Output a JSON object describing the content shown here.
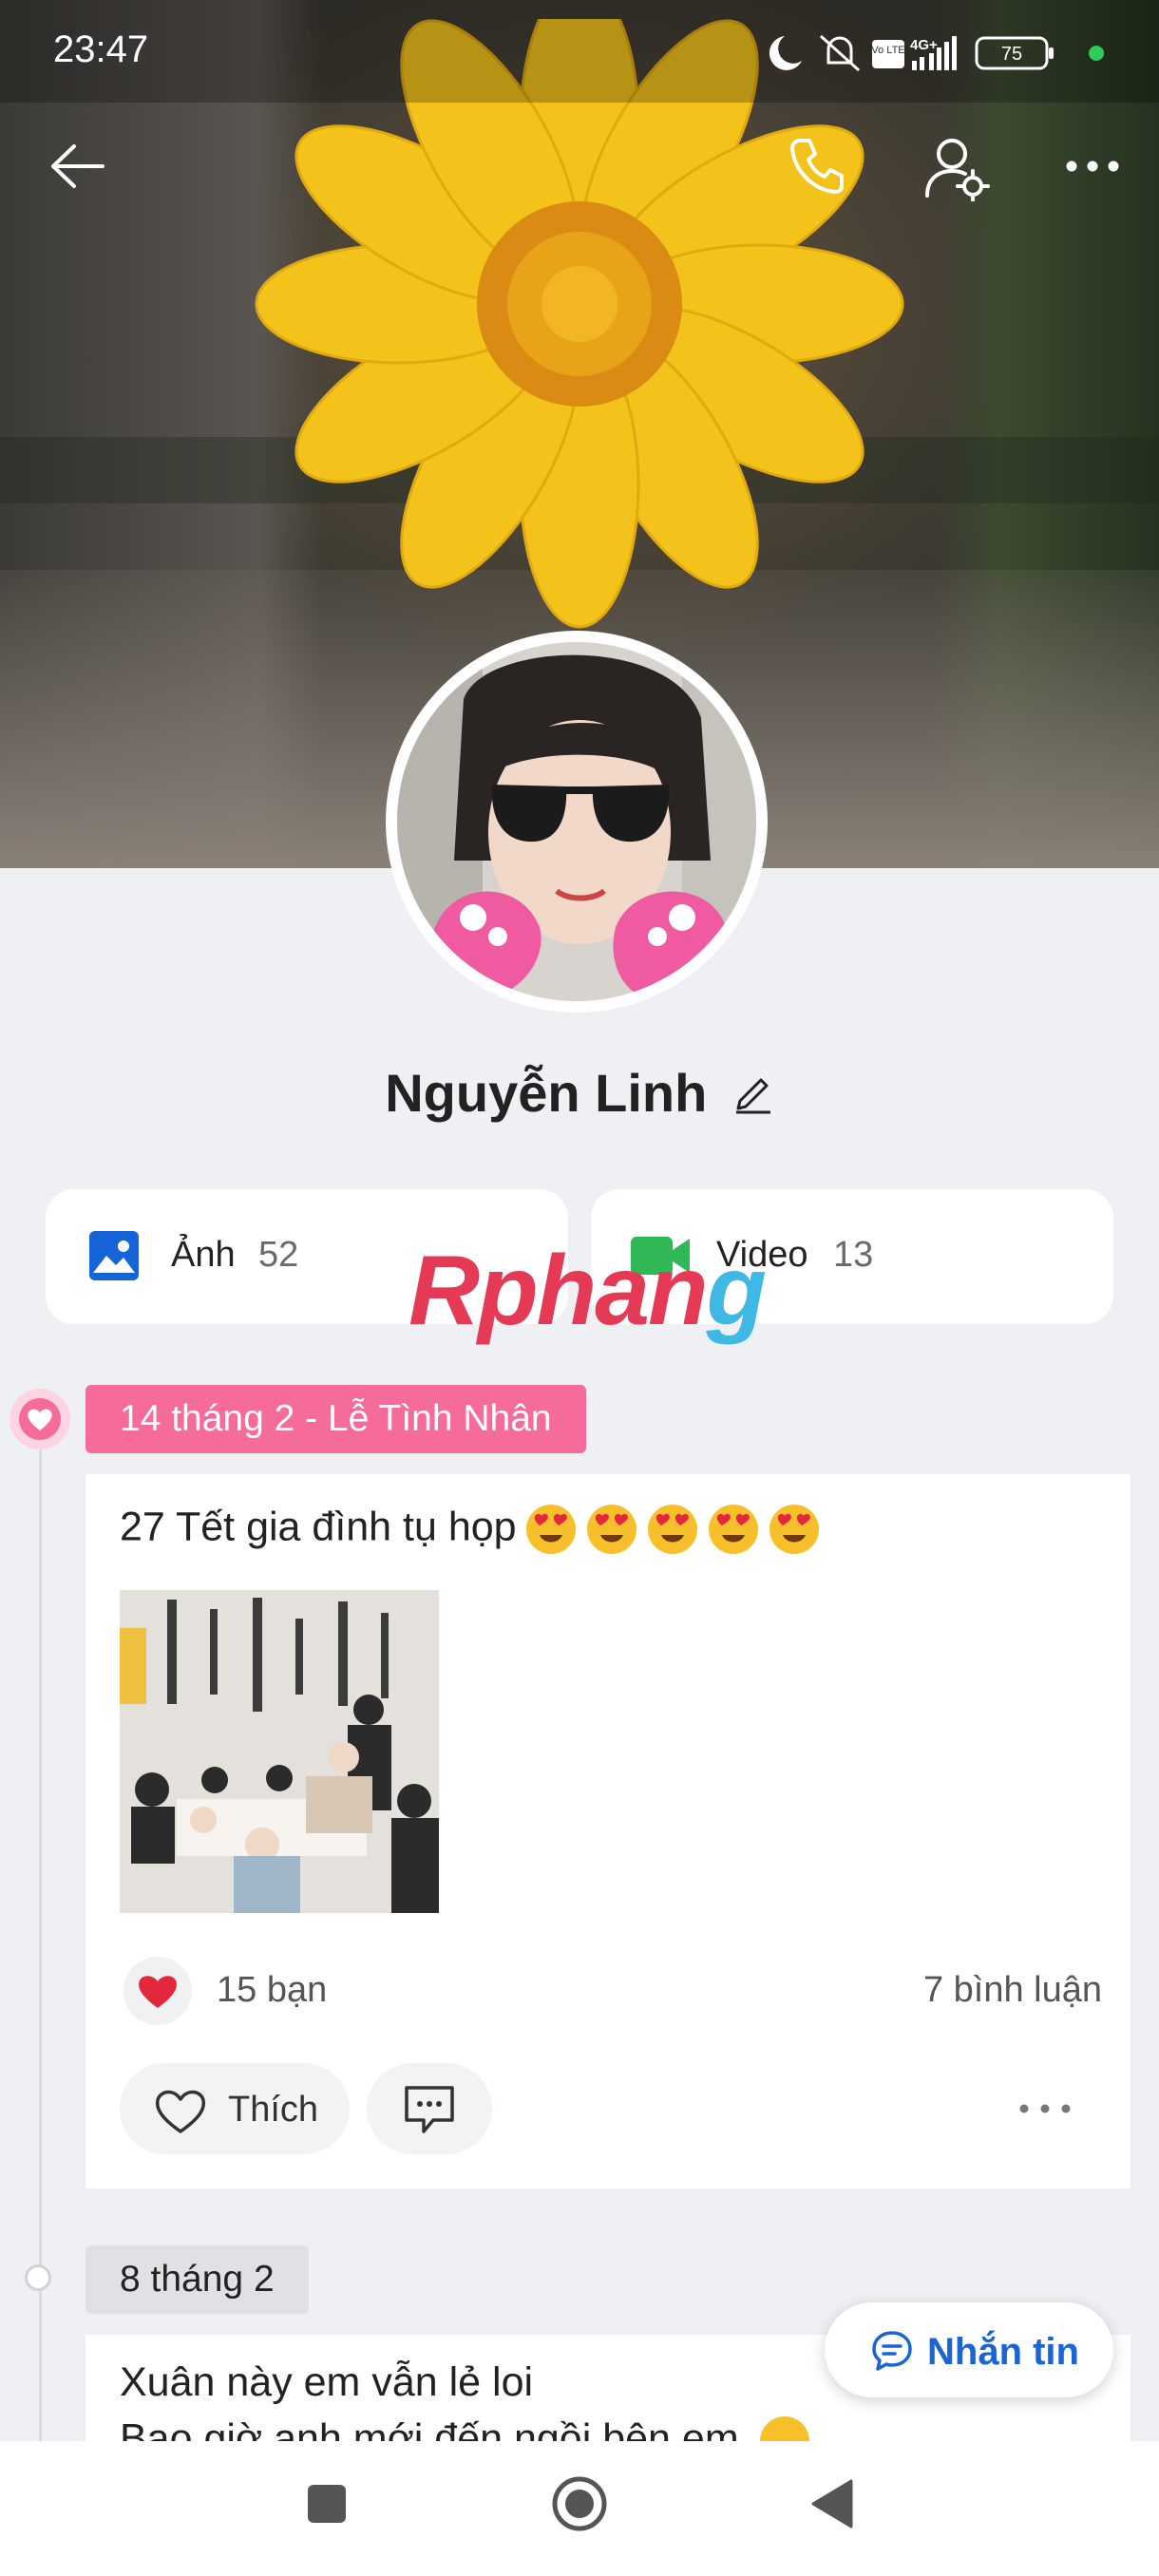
{
  "status_bar": {
    "time": "23:47",
    "battery": "75",
    "network": "4G+",
    "volte": "Vo LTE"
  },
  "profile": {
    "name": "Nguyễn Linh"
  },
  "media": {
    "photos": {
      "label": "Ảnh",
      "count": "52"
    },
    "videos": {
      "label": "Video",
      "count": "13"
    }
  },
  "watermark": {
    "part1": "Rphan",
    "part2": "g"
  },
  "timeline": {
    "occasion": "14 tháng 2 - Lễ Tình Nhân",
    "post1": {
      "text": "27 Tết gia đình tụ họp",
      "emoji_count": 5,
      "likes": "15 bạn",
      "comments": "7 bình luận",
      "like_label": "Thích"
    },
    "date2": "8 tháng 2",
    "post2": {
      "line1": "Xuân này em vẫn lẻ loi",
      "line2": "Bao giờ anh mới đến ngồi bên em"
    }
  },
  "actions": {
    "message_label": "Nhắn tin"
  },
  "colors": {
    "accent_pink": "#f56b9a",
    "link_blue": "#1a64d6",
    "photo_icon_blue": "#1565d8",
    "video_icon_green": "#2fb855"
  }
}
